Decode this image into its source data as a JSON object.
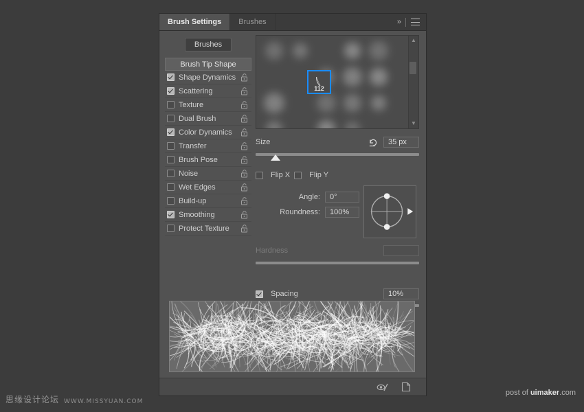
{
  "panel": {
    "tabs": [
      {
        "label": "Brush Settings",
        "active": true
      },
      {
        "label": "Brushes",
        "active": false
      }
    ],
    "collapse_icon": "chevron-double-right-icon",
    "menu_icon": "hamburger-menu-icon",
    "brushes_button": "Brushes"
  },
  "sidebar": {
    "header": "Brush Tip Shape",
    "items": [
      {
        "label": "Shape Dynamics",
        "checked": true,
        "lock": "unlocked"
      },
      {
        "label": "Scattering",
        "checked": true,
        "lock": "unlocked"
      },
      {
        "label": "Texture",
        "checked": false,
        "lock": "unlocked"
      },
      {
        "label": "Dual Brush",
        "checked": false,
        "lock": "unlocked"
      },
      {
        "label": "Color Dynamics",
        "checked": true,
        "lock": "unlocked"
      },
      {
        "label": "Transfer",
        "checked": false,
        "lock": "unlocked"
      },
      {
        "label": "Brush Pose",
        "checked": false,
        "lock": "unlocked"
      },
      {
        "label": "Noise",
        "checked": false,
        "lock": "unlocked"
      },
      {
        "label": "Wet Edges",
        "checked": false,
        "lock": "unlocked"
      },
      {
        "label": "Build-up",
        "checked": false,
        "lock": "unlocked"
      },
      {
        "label": "Smoothing",
        "checked": true,
        "lock": "unlocked"
      },
      {
        "label": "Protect Texture",
        "checked": false,
        "lock": "unlocked"
      }
    ]
  },
  "brush_grid": {
    "selected_brush_number": "112",
    "scrollbar": {
      "up_arrow": "chevron-up-icon",
      "down_arrow": "chevron-down-icon"
    }
  },
  "controls": {
    "size": {
      "label": "Size",
      "value": "35 px",
      "reset_icon": "reset-arrow-icon",
      "slider_percent": 12
    },
    "flip_x": {
      "label": "Flip X",
      "checked": false
    },
    "flip_y": {
      "label": "Flip Y",
      "checked": false
    },
    "angle": {
      "label": "Angle:",
      "value": "0°"
    },
    "roundness": {
      "label": "Roundness:",
      "value": "100%"
    },
    "hardness": {
      "label": "Hardness",
      "value": "",
      "disabled": true,
      "slider_percent": 0
    },
    "spacing": {
      "label": "Spacing",
      "checked": true,
      "value": "10%",
      "slider_percent": 3
    }
  },
  "footer": {
    "toggle_preview_icon": "eye-slash-icon",
    "new_brush_icon": "new-document-icon"
  },
  "watermarks": {
    "left_cn": "思缘设计论坛",
    "left_url": "WWW.MISSYUAN.COM",
    "right_prefix": "post of ",
    "right_brand": "uimaker",
    "right_suffix": ".com"
  },
  "colors": {
    "panel_bg": "#525252",
    "tab_bar": "#3b3b3b",
    "selection_blue": "#1a8cff",
    "app_bg": "#3c3c3c"
  }
}
